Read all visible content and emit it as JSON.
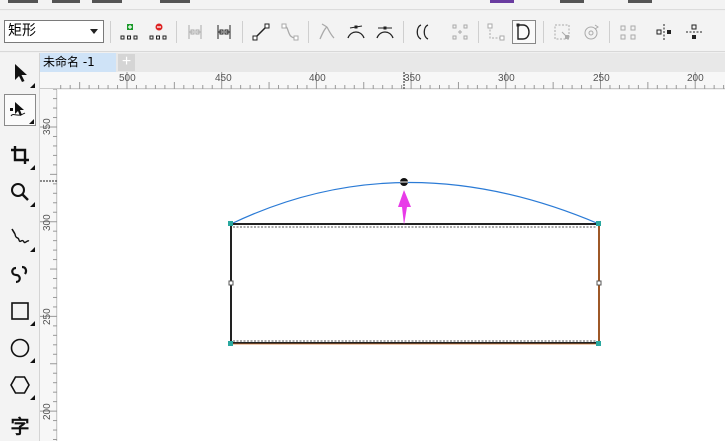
{
  "property_bar": {
    "object_type": "矩形"
  },
  "document": {
    "tab_title": "未命名 -1",
    "add_tab": "+"
  },
  "toolbox": {
    "text_tool": "字"
  },
  "rulers": {
    "horizontal": [
      "500",
      "450",
      "400",
      "350",
      "300",
      "250",
      "200"
    ],
    "vertical": [
      "350",
      "300",
      "250",
      "200"
    ]
  },
  "colors": {
    "arc": "#2b7bd6",
    "handle": "#111111",
    "arrow": "#e83be8",
    "rect_outline": "#222222",
    "rect_accent": "#d4702a",
    "node": "#2aa8a0"
  }
}
